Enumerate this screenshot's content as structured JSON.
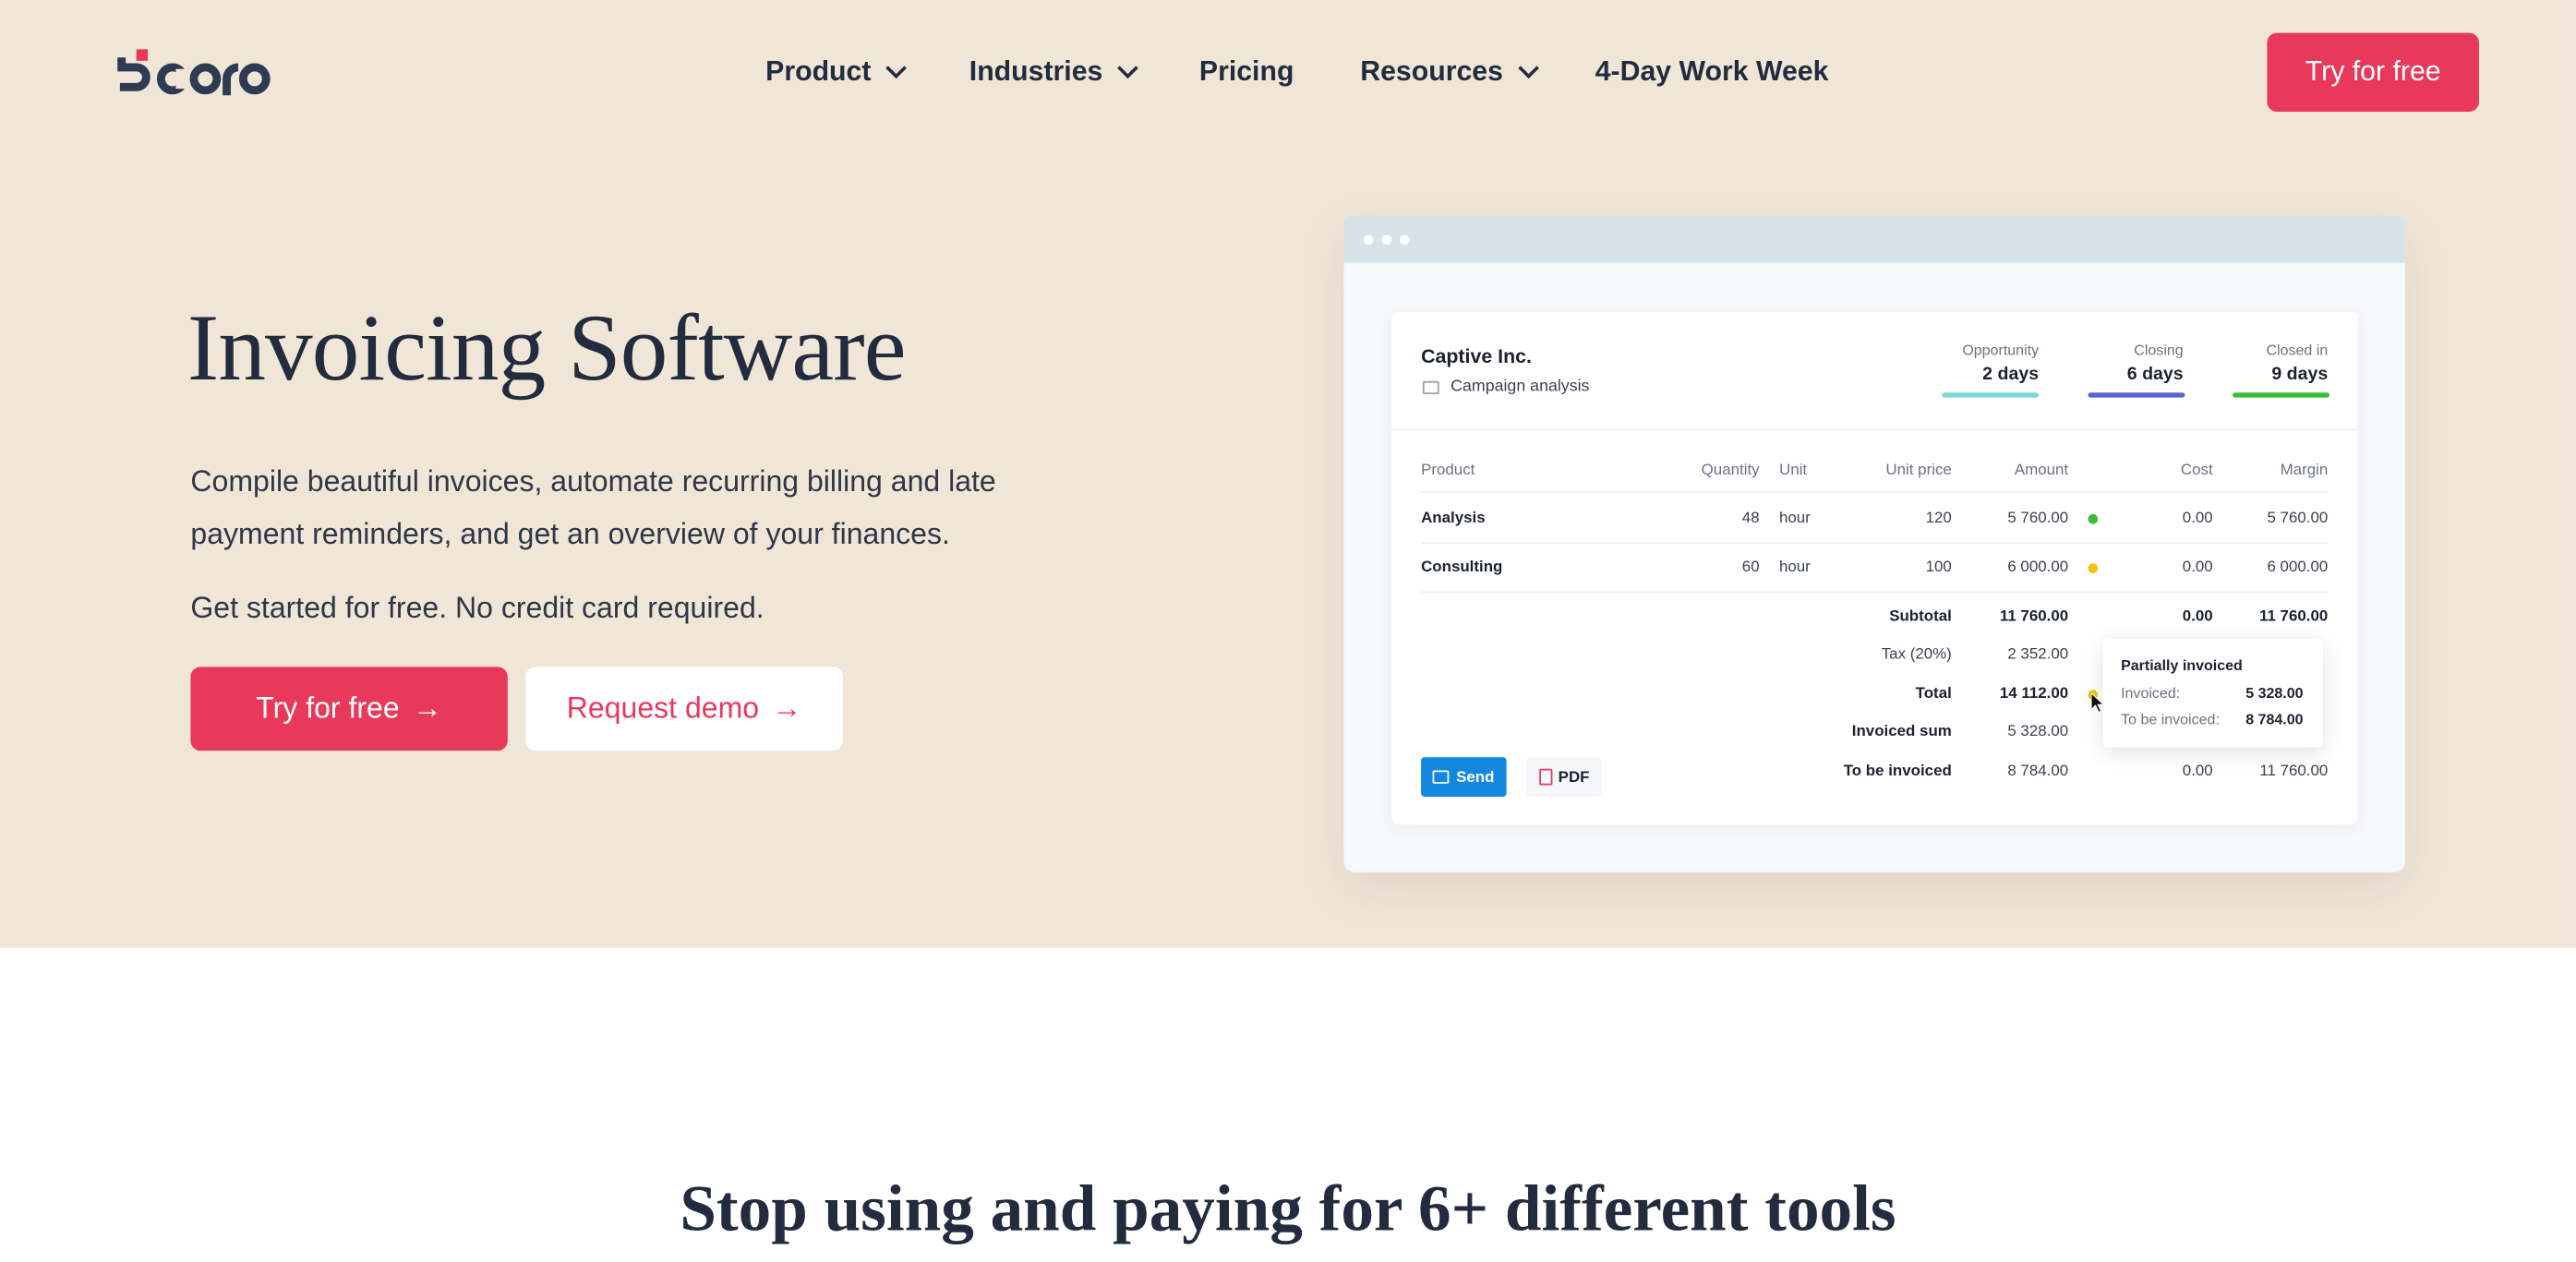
{
  "brand": {
    "logo_text": "Scoro",
    "accent": "#e8395a"
  },
  "nav": {
    "items": [
      {
        "label": "Product",
        "has_dropdown": true
      },
      {
        "label": "Industries",
        "has_dropdown": true
      },
      {
        "label": "Pricing",
        "has_dropdown": false
      },
      {
        "label": "Resources",
        "has_dropdown": true
      },
      {
        "label": "4-Day Work Week",
        "has_dropdown": false
      }
    ],
    "cta": "Try for free"
  },
  "hero": {
    "title": "Invoicing Software",
    "description": "Compile beautiful invoices, automate recurring billing and late payment reminders, and get an overview of your finances.",
    "note": "Get started for free. No credit card required.",
    "primary_button": "Try for free",
    "secondary_button": "Request demo"
  },
  "mockup": {
    "client": "Captive Inc.",
    "project": "Campaign analysis",
    "stages": [
      {
        "label": "Opportunity",
        "value": "2 days",
        "color": "#7fd8d3"
      },
      {
        "label": "Closing",
        "value": "6 days",
        "color": "#5a67c9"
      },
      {
        "label": "Closed in",
        "value": "9 days",
        "color": "#3dba3a"
      }
    ],
    "columns": [
      "Product",
      "Quantity",
      "Unit",
      "Unit price",
      "Amount",
      "Cost",
      "Margin"
    ],
    "rows": [
      {
        "product": "Analysis",
        "quantity": "48",
        "unit": "hour",
        "unit_price": "120",
        "amount": "5 760.00",
        "status_color": "#3dba3a",
        "cost": "0.00",
        "margin": "5 760.00"
      },
      {
        "product": "Consulting",
        "quantity": "60",
        "unit": "hour",
        "unit_price": "100",
        "amount": "6 000.00",
        "status_color": "#f2c40f",
        "cost": "0.00",
        "margin": "6 000.00"
      }
    ],
    "summary": {
      "subtotal": {
        "label": "Subtotal",
        "amount": "11 760.00",
        "cost": "0.00",
        "margin": "11 760.00"
      },
      "tax": {
        "label": "Tax (20%)",
        "amount": "2 352.00"
      },
      "total": {
        "label": "Total",
        "amount": "14 112.00"
      },
      "invoiced": {
        "label": "Invoiced sum",
        "amount": "5 328.00"
      },
      "to_be_invoiced": {
        "label": "To be invoiced",
        "amount": "8 784.00",
        "cost": "0.00",
        "margin": "11 760.00"
      }
    },
    "send_label": "Send",
    "pdf_label": "PDF",
    "tooltip": {
      "title": "Partially invoiced",
      "invoiced_label": "Invoiced:",
      "invoiced_value": "5 328.00",
      "to_be_label": "To be invoiced:",
      "to_be_value": "8 784.00"
    }
  },
  "section2": {
    "title": "Stop using and paying for 6+ different tools"
  }
}
